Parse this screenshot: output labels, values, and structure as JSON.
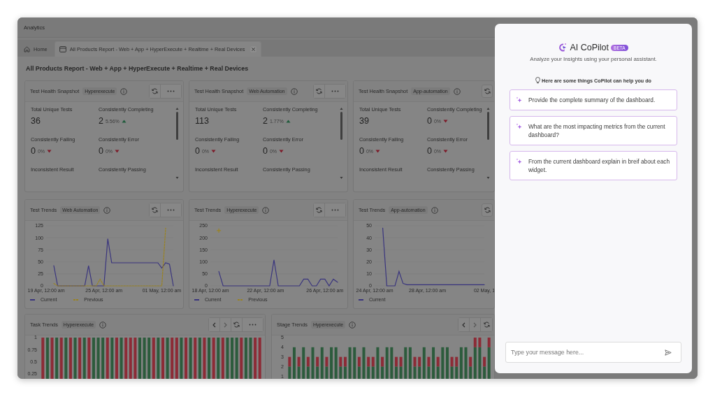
{
  "window": {
    "title": "Analytics"
  },
  "tabs": [
    {
      "label": "Home",
      "kind": "home",
      "selected": false,
      "closable": false
    },
    {
      "label": "All Products Report - Web + App + HyperExecute + Realtime + Real Devices",
      "kind": "report",
      "selected": true,
      "closable": true
    }
  ],
  "report_title": "All Products Report - Web + App + HyperExecute + Realtime + Real Devices",
  "health_cards": [
    {
      "title": "Test Health Snapshot",
      "tag": "Hyperexecute",
      "metrics": [
        {
          "label": "Total Unique Tests",
          "value": "36"
        },
        {
          "label": "Consistently Completing",
          "value": "2",
          "change": "5.56%",
          "increase": true
        },
        {
          "label": "Consistently Failing",
          "value": "0",
          "change": "0%",
          "increase": false
        },
        {
          "label": "Consistently Error",
          "value": "0",
          "change": "0%",
          "increase": false
        },
        {
          "label": "Inconsistent Result"
        },
        {
          "label": "Consistently Passing"
        }
      ]
    },
    {
      "title": "Test Health Snapshot",
      "tag": "Web Automation",
      "metrics": [
        {
          "label": "Total Unique Tests",
          "value": "113"
        },
        {
          "label": "Consistently Completing",
          "value": "2",
          "change": "1.77%",
          "increase": true
        },
        {
          "label": "Consistently Failing",
          "value": "0",
          "change": "0%",
          "increase": false
        },
        {
          "label": "Consistently Error",
          "value": "0",
          "change": "0%",
          "increase": false
        },
        {
          "label": "Inconsistent Result"
        },
        {
          "label": "Consistently Passing"
        }
      ]
    },
    {
      "title": "Test Health Snapshot",
      "tag": "App-automation",
      "metrics": [
        {
          "label": "Total Unique Tests",
          "value": "39"
        },
        {
          "label": "Consistently Completing",
          "value": "0",
          "change": "0%",
          "increase": false
        },
        {
          "label": "Consistently Failing",
          "value": "0",
          "change": "0%",
          "increase": false
        },
        {
          "label": "Consistently Error",
          "value": "0",
          "change": "0%",
          "increase": false
        },
        {
          "label": "Inconsistent Result"
        },
        {
          "label": "Consistently Passing"
        }
      ]
    }
  ],
  "trend_cards": [
    {
      "title": "Test Trends",
      "tag": "Web Automation",
      "chart_data": {
        "type": "line",
        "legend": "bottom",
        "ylim": [
          0,
          125
        ],
        "yticks": [
          0,
          25,
          50,
          75,
          100,
          125
        ],
        "categories": [
          "19 Apr, 12:00 am",
          null,
          null,
          null,
          null,
          null,
          null,
          null,
          null,
          null,
          null,
          null,
          null,
          null,
          null,
          "25 Apr, 12:00 am",
          null,
          null,
          null,
          null,
          null,
          null,
          null,
          null,
          null,
          null,
          null,
          null,
          null,
          null,
          "01 May, 12:00 am",
          null,
          null,
          null
        ],
        "series": [
          {
            "name": "Current",
            "color": "#3a357e",
            "line_style": "solid",
            "values": [
              null,
              null,
              42,
              0,
              0,
              0,
              0,
              0,
              0,
              0,
              0,
              42,
              0,
              0,
              0,
              0,
              98,
              48,
              48,
              48,
              48,
              48,
              48,
              48,
              48,
              48,
              48,
              48,
              48,
              48,
              37,
              48,
              45,
              0
            ]
          },
          {
            "name": "Previous",
            "color": "#9a8322",
            "line_style": "dashed",
            "values": [
              null,
              null,
              5,
              0,
              0,
              0,
              0,
              0,
              0,
              0,
              0,
              0,
              0,
              0,
              14,
              0,
              0,
              0,
              0,
              0,
              0,
              0,
              0,
              0,
              0,
              0,
              0,
              0,
              0,
              0,
              0,
              120,
              null,
              null
            ]
          }
        ]
      }
    },
    {
      "title": "Test Trends",
      "tag": "Hyperexecute",
      "chart_data": {
        "type": "line",
        "legend": "bottom",
        "ylim": [
          0,
          250
        ],
        "yticks": [
          0,
          50,
          100,
          150,
          200,
          250
        ],
        "categories": [
          "18 Apr, 12:00 am",
          null,
          null,
          null,
          null,
          null,
          null,
          null,
          null,
          null,
          null,
          null,
          null,
          "22 Apr, 12:00 am",
          null,
          null,
          null,
          null,
          null,
          null,
          null,
          null,
          null,
          null,
          null,
          null,
          null,
          "26 Apr, 12:00 am",
          null,
          null,
          null
        ],
        "series": [
          {
            "name": "Current",
            "color": "#3a357e",
            "line_style": "solid",
            "values": [
              null,
              null,
              60,
              0,
              0,
              0,
              0,
              0,
              0,
              0,
              0,
              0,
              0,
              0,
              0,
              108,
              0,
              0,
              0,
              0,
              0,
              0,
              28,
              28,
              0,
              0,
              28,
              28,
              0,
              28,
              15
            ]
          },
          {
            "name": "Previous",
            "color": "#9a8322",
            "line_style": "dashed",
            "marker": "plus",
            "values": [
              null,
              null,
              230,
              null,
              null,
              null,
              null,
              null,
              null,
              null,
              null,
              null,
              null,
              null,
              null,
              null,
              null,
              null,
              null,
              null,
              null,
              null,
              null,
              null,
              null,
              null,
              null,
              null,
              null,
              null,
              null
            ]
          }
        ]
      }
    },
    {
      "title": "Test Trends",
      "tag": "App-automation",
      "chart_data": {
        "type": "line",
        "legend": "bottom",
        "ylim": [
          0,
          50
        ],
        "yticks": [
          0,
          10,
          20,
          30,
          40,
          50
        ],
        "categories": [
          "24 Apr, 12:00 am",
          null,
          null,
          null,
          null,
          null,
          null,
          null,
          null,
          null,
          null,
          null,
          null,
          "28 Apr, 12:00 am",
          null,
          null,
          null,
          null,
          null,
          null,
          null,
          null,
          null,
          null,
          null,
          null,
          null,
          "02 May, 1"
        ],
        "series": [
          {
            "name": "Current",
            "color": "#3a357e",
            "line_style": "solid",
            "values": [
              null,
              null,
              48,
              0,
              0,
              0,
              12,
              2,
              1,
              1,
              1,
              1,
              1,
              1,
              1,
              1,
              1,
              1,
              1,
              1,
              1,
              1,
              1,
              1,
              1,
              1,
              1,
              1
            ]
          }
        ]
      }
    }
  ],
  "bar_cards": [
    {
      "title": "Task Trends",
      "tag": "Hyperexecute",
      "chart_data": {
        "type": "bar",
        "stacked": true,
        "ylim": [
          0,
          1
        ],
        "yticks": [
          0.25,
          0.5,
          0.75,
          1
        ],
        "series": [
          {
            "color": "#2c5b3c",
            "values": [
              0,
              1,
              0,
              1,
              0,
              1,
              0,
              1,
              0,
              1,
              0,
              1,
              1,
              1,
              0,
              1,
              0,
              1,
              0,
              0,
              0,
              1,
              1,
              1,
              0,
              1,
              0,
              1,
              0,
              0,
              1,
              0,
              1,
              0,
              1,
              0,
              1,
              0,
              1,
              0,
              1,
              1,
              1,
              0,
              1,
              1,
              0,
              0
            ]
          },
          {
            "color": "#8c2b36",
            "values": [
              1,
              0,
              1,
              0,
              1,
              0,
              1,
              0,
              1,
              0,
              1,
              0,
              0,
              0,
              1,
              0,
              1,
              0,
              1,
              1,
              1,
              0,
              0,
              0,
              1,
              0,
              1,
              0,
              1,
              1,
              0,
              1,
              0,
              1,
              0,
              1,
              0,
              1,
              0,
              1,
              0,
              0,
              0,
              1,
              0,
              0,
              1,
              1
            ]
          }
        ]
      }
    },
    {
      "title": "Stage Trends",
      "tag": "Hyperexecute",
      "chart_data": {
        "type": "bar",
        "stacked": true,
        "ylim": [
          0,
          5
        ],
        "yticks": [
          1,
          2,
          3,
          4,
          5
        ],
        "series": [
          {
            "color": "#2c5b3c",
            "values": [
              2,
              4,
              2,
              4,
              2,
              4,
              2,
              4,
              2,
              4,
              4,
              2,
              2,
              4,
              4,
              2,
              4,
              2,
              2,
              4,
              2,
              4,
              4,
              2,
              2,
              4,
              4,
              2,
              2,
              4,
              2,
              4,
              2,
              4,
              4,
              2,
              2,
              4,
              4,
              2,
              4,
              4,
              2,
              4
            ]
          },
          {
            "color": "#8c2b36",
            "values": [
              1,
              0,
              1,
              0,
              1,
              0,
              1,
              0,
              1,
              0,
              0,
              1,
              1,
              0,
              0,
              1,
              0,
              1,
              1,
              0,
              1,
              0,
              0,
              1,
              1,
              0,
              0,
              1,
              1,
              0,
              1,
              0,
              1,
              0,
              0,
              1,
              1,
              0,
              0,
              1,
              1,
              1,
              1,
              1
            ]
          }
        ]
      }
    }
  ],
  "copilot": {
    "title": "AI CoPilot",
    "badge": "BETA",
    "subtitle": "Analyze your Insights using your personal assistant.",
    "hint": "Here are some things CoPilot can help you do",
    "suggestions": [
      "Provide the complete summary of the dashboard.",
      "What are the most impacting metrics from the current dashboard?",
      "From the current dashboard explain in breif about each widget."
    ],
    "input": {
      "placeholder": "Type your message here..."
    }
  }
}
